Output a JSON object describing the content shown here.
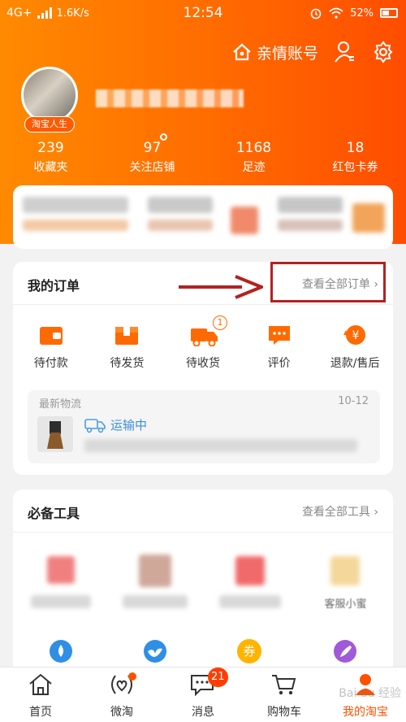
{
  "status_bar": {
    "network": "4G+",
    "speed": "1.6K/s",
    "time": "12:54",
    "battery": "52%"
  },
  "header": {
    "family_account": "亲情账号",
    "avatar_badge": "淘宝人生",
    "stats": [
      {
        "num": "239",
        "label": "收藏夹"
      },
      {
        "num": "97",
        "label": "关注店铺"
      },
      {
        "num": "1168",
        "label": "足迹"
      },
      {
        "num": "18",
        "label": "红包卡券"
      }
    ]
  },
  "orders": {
    "title": "我的订单",
    "view_all": "查看全部订单",
    "items": [
      {
        "label": "待付款",
        "icon": "wallet-icon"
      },
      {
        "label": "待发货",
        "icon": "package-icon"
      },
      {
        "label": "待收货",
        "icon": "truck-icon",
        "badge": "1"
      },
      {
        "label": "评价",
        "icon": "review-icon"
      },
      {
        "label": "退款/售后",
        "icon": "refund-icon"
      }
    ],
    "logistics": {
      "title": "最新物流",
      "date": "10-12",
      "status": "运输中"
    }
  },
  "tools": {
    "title": "必备工具",
    "view_all": "查看全部工具",
    "fourth_label": "客服小蜜",
    "bottom_icon_label": "券"
  },
  "tabbar": {
    "items": [
      {
        "label": "首页",
        "icon": "home-icon"
      },
      {
        "label": "微淘",
        "icon": "weitao-icon"
      },
      {
        "label": "消息",
        "icon": "message-icon",
        "badge": "21"
      },
      {
        "label": "购物车",
        "icon": "cart-icon"
      },
      {
        "label": "我的淘宝",
        "icon": "profile-icon",
        "active": true
      }
    ]
  },
  "watermark": "Bai du 经验",
  "colors": {
    "brand": "#ff5000",
    "annotation": "#b22222"
  }
}
